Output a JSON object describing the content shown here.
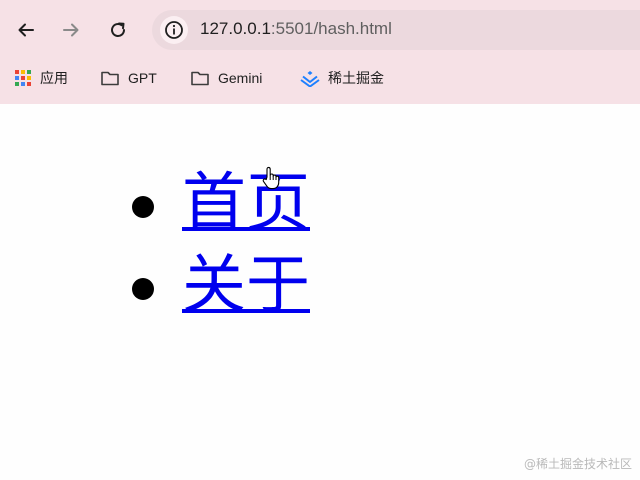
{
  "browser": {
    "url_host": "127.0.0.1",
    "url_path": ":5501/hash.html",
    "bookmarks": [
      {
        "label": "应用",
        "icon": "apps-grid-icon"
      },
      {
        "label": "GPT",
        "icon": "folder-icon"
      },
      {
        "label": "Gemini",
        "icon": "folder-icon"
      },
      {
        "label": "稀土掘金",
        "icon": "juejin-logo-icon"
      }
    ]
  },
  "page": {
    "nav_items": [
      {
        "label": "首页"
      },
      {
        "label": "关于"
      }
    ],
    "link_color": "#0000ee"
  },
  "watermark": "@稀土掘金技术社区"
}
